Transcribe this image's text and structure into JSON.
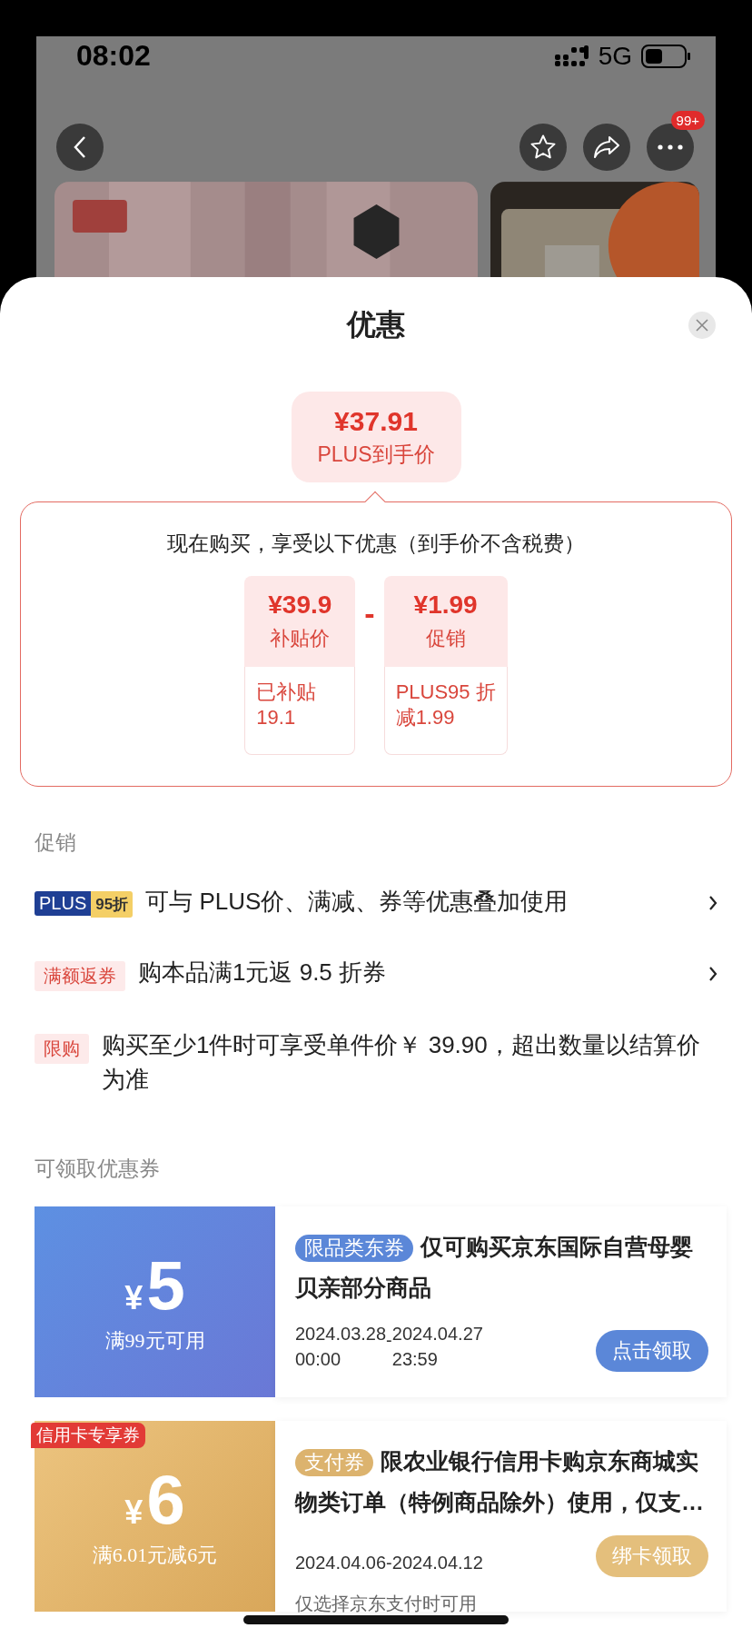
{
  "status_bar": {
    "time": "08:02",
    "network": "5G"
  },
  "nav": {
    "notification_badge": "99+"
  },
  "sheet": {
    "title": "优惠"
  },
  "final_price": {
    "amount": "¥37.91",
    "label": "PLUS到手价"
  },
  "breakdown": {
    "intro": "现在购买，享受以下优惠（到手价不含税费）",
    "operator": "-",
    "items": [
      {
        "amount": "¥39.9",
        "label": "补贴价",
        "note": [
          "已补贴",
          "19.1"
        ]
      },
      {
        "amount": "¥1.99",
        "label": "促销",
        "note": [
          "PLUS95 折",
          "减1.99"
        ]
      }
    ]
  },
  "promotions": {
    "heading": "促销",
    "rows": [
      {
        "kind": "plus",
        "tag": "PLUS",
        "tag_extra": "95折",
        "text": "可与 PLUS价、满减、券等优惠叠加使用",
        "has_arrow": true
      },
      {
        "kind": "tag",
        "tag": "满额返券",
        "text": "购本品满1元返 9.5 折券",
        "has_arrow": true
      },
      {
        "kind": "tag",
        "tag": "限购",
        "text": "购买至少1件时可享受单件价￥ 39.90，超出数量以结算价为准",
        "has_arrow": false
      }
    ]
  },
  "coupons": {
    "heading": "可领取优惠券",
    "items": [
      {
        "kind": "blue",
        "currency": "¥",
        "amount": "5",
        "condition": "满99元可用",
        "tag": "限品类东券",
        "description": "仅可购买京东国际自营母婴贝亲部分商品",
        "start": {
          "date": "2024.03.28",
          "time": "00:00"
        },
        "separator": "-",
        "end": {
          "date": "2024.04.27",
          "time": "23:59"
        },
        "button": "点击领取"
      },
      {
        "kind": "gold",
        "ribbon": "信用卡专享券",
        "currency": "¥",
        "amount": "6",
        "condition": "满6.01元减6元",
        "tag": "支付券",
        "description": "限农业银行信用卡购京东商城实物类订单（特例商品除外）使用，仅支…",
        "period": "2024.04.06-2024.04.12",
        "button": "绑卡领取",
        "note": "仅选择京东支付时可用"
      }
    ]
  }
}
